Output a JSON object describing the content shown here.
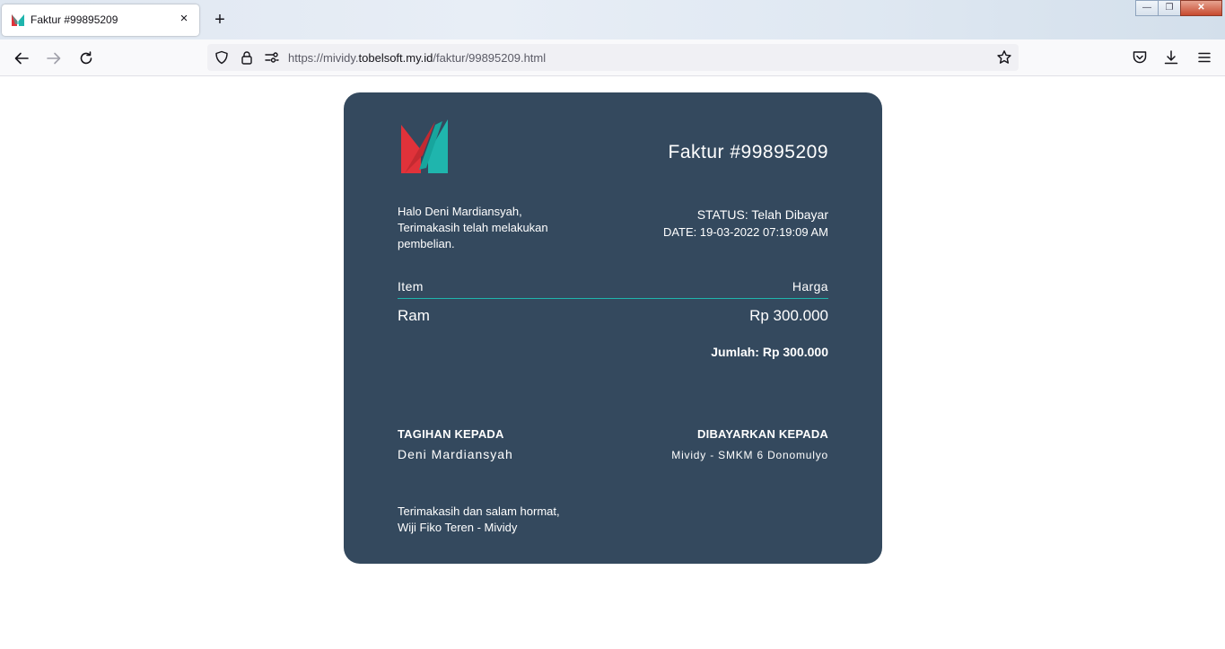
{
  "browser": {
    "tab_title": "Faktur #99895209",
    "new_tab_label": "+",
    "close_tab_label": "×",
    "url_prefix": "https://mividy.",
    "url_domain": "tobelsoft.my.id",
    "url_path": "/faktur/99895209.html",
    "window_controls": {
      "minimize": "—",
      "restore": "❐",
      "close": "✕"
    }
  },
  "invoice": {
    "title": "Faktur #99895209",
    "greeting_line1": "Halo Deni Mardiansyah,",
    "greeting_line2": "Terimakasih telah melakukan pembelian.",
    "status_label": "STATUS:",
    "status_value": "Telah Dibayar",
    "date_label": "DATE:",
    "date_value": "19-03-2022 07:19:09 AM",
    "columns": {
      "item": "Item",
      "price": "Harga"
    },
    "items": [
      {
        "name": "Ram",
        "price": "Rp 300.000"
      }
    ],
    "total": "Jumlah: Rp 300.000",
    "bill_to_label": "TAGIHAN KEPADA",
    "bill_to_name": "Deni Mardiansyah",
    "pay_to_label": "DIBAYARKAN KEPADA",
    "pay_to_name": "Mividy - SMKM 6 Donomulyo",
    "signoff_line1": "Terimakasih dan salam hormat,",
    "signoff_line2": "Wiji Fiko Teren - Mividy"
  },
  "colors": {
    "card_bg": "#34495e",
    "accent_teal": "#1fb5ad",
    "logo_red": "#e0323a"
  },
  "icons": [
    "m-logo-icon",
    "back-arrow-icon",
    "forward-arrow-icon",
    "reload-icon",
    "shield-icon",
    "lock-icon",
    "permissions-icon",
    "star-icon",
    "pocket-icon",
    "download-icon",
    "menu-icon",
    "close-icon",
    "plus-icon"
  ]
}
